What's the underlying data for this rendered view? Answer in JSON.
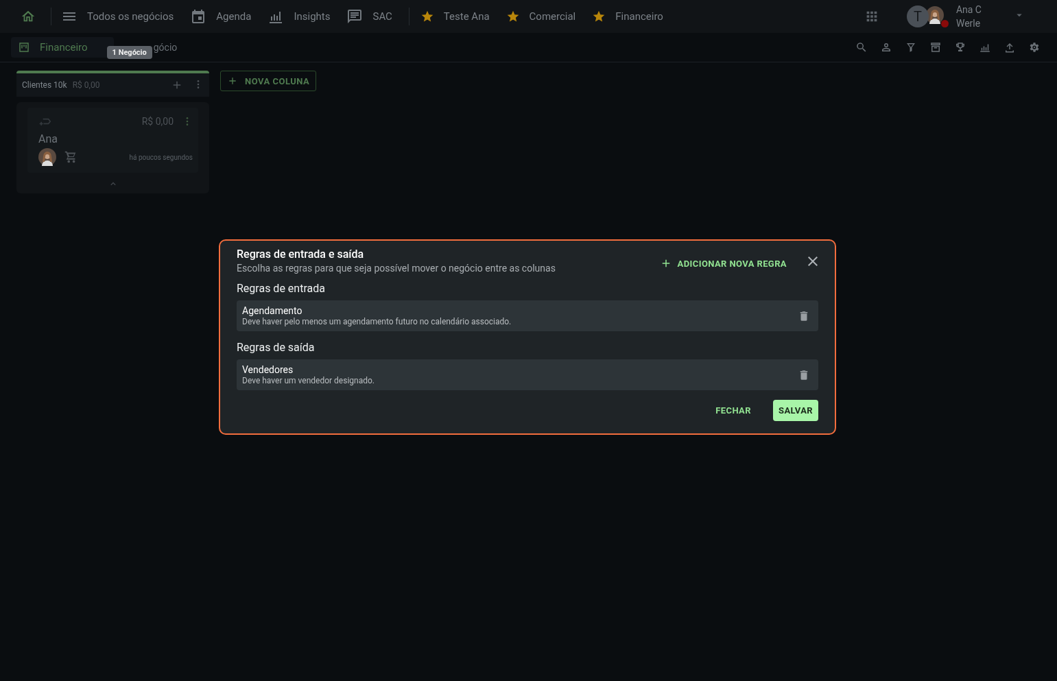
{
  "nav": {
    "items": [
      {
        "label": "Todos os negócios"
      },
      {
        "label": "Agenda"
      },
      {
        "label": "Insights"
      },
      {
        "label": "SAC"
      }
    ],
    "favorites": [
      {
        "label": "Teste Ana"
      },
      {
        "label": "Comercial"
      },
      {
        "label": "Financeiro"
      }
    ],
    "user": {
      "initial": "T",
      "name_lines": [
        "Ana C",
        "Werle"
      ]
    }
  },
  "board_bar": {
    "title": "Financeiro",
    "covered_text": "gócio",
    "tooltip": "1 Negócio"
  },
  "column": {
    "title": "Clientes 10k",
    "total": "R$ 0,00",
    "card": {
      "amount": "R$ 0,00",
      "name": "Ana",
      "time": "há poucos segundos"
    }
  },
  "new_column_button": "NOVA COLUNA",
  "modal": {
    "title": "Regras de entrada e saída",
    "subtitle": "Escolha as regras para que seja possível mover o negócio entre as colunas",
    "add_button": "ADICIONAR NOVA REGRA",
    "sections": [
      {
        "heading": "Regras de entrada",
        "rules": [
          {
            "name": "Agendamento",
            "description": "Deve haver pelo menos um agendamento futuro no calendário associado."
          }
        ]
      },
      {
        "heading": "Regras de saída",
        "rules": [
          {
            "name": "Vendedores",
            "description": "Deve haver um vendedor designado."
          }
        ]
      }
    ],
    "close_button": "FECHAR",
    "save_button": "SALVAR"
  }
}
